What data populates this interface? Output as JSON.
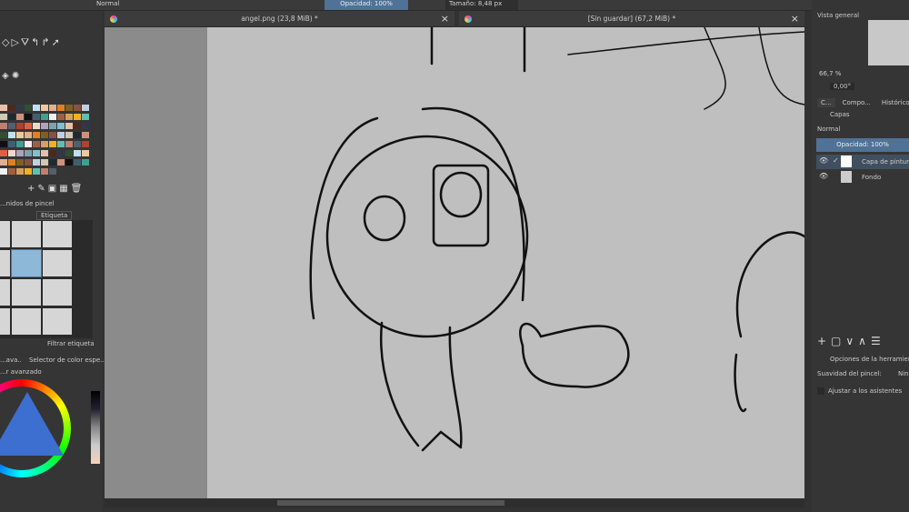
{
  "toolbar": {
    "blend_mode": "Normal",
    "opacity": "Opacidad: 100%",
    "size": "Tamaño: 8,48 px"
  },
  "tabs": [
    {
      "title": "angel.png (23,8 MiB) *"
    },
    {
      "title": "[Sin guardar]  (67,2 MiB) *"
    }
  ],
  "left_panel": {
    "brush_presets_title": "...nidos de pincel",
    "tag_label": "Etiqueta",
    "filter_tag": "Filtrar etiqueta",
    "color_tabs": [
      "...ava...",
      "Selector de color espe..."
    ],
    "advanced_selector": "...r avanzado"
  },
  "right_panel": {
    "overview_title": "Vista general",
    "zoom": "66,7 %",
    "rotation": "0,00°",
    "tabs": [
      "C...",
      "Compo...",
      "Histórico"
    ],
    "layers_title": "Capas",
    "blend_mode": "Normal",
    "opacity": "Opacidad:  100%",
    "layers": [
      {
        "name": "Capa de pintura",
        "visible": true,
        "selected": true
      },
      {
        "name": "Fondo",
        "visible": true,
        "selected": false
      }
    ],
    "tool_options_title": "Opciones de la herramienta",
    "smoothing_label": "Suavidad del pincel:",
    "smoothing_value": "Ninguna",
    "snap_label": "Ajustar a los asistentes"
  },
  "colors": {
    "accent": "#4f7296",
    "canvas": "#bfbfbf",
    "panel": "#353535"
  }
}
